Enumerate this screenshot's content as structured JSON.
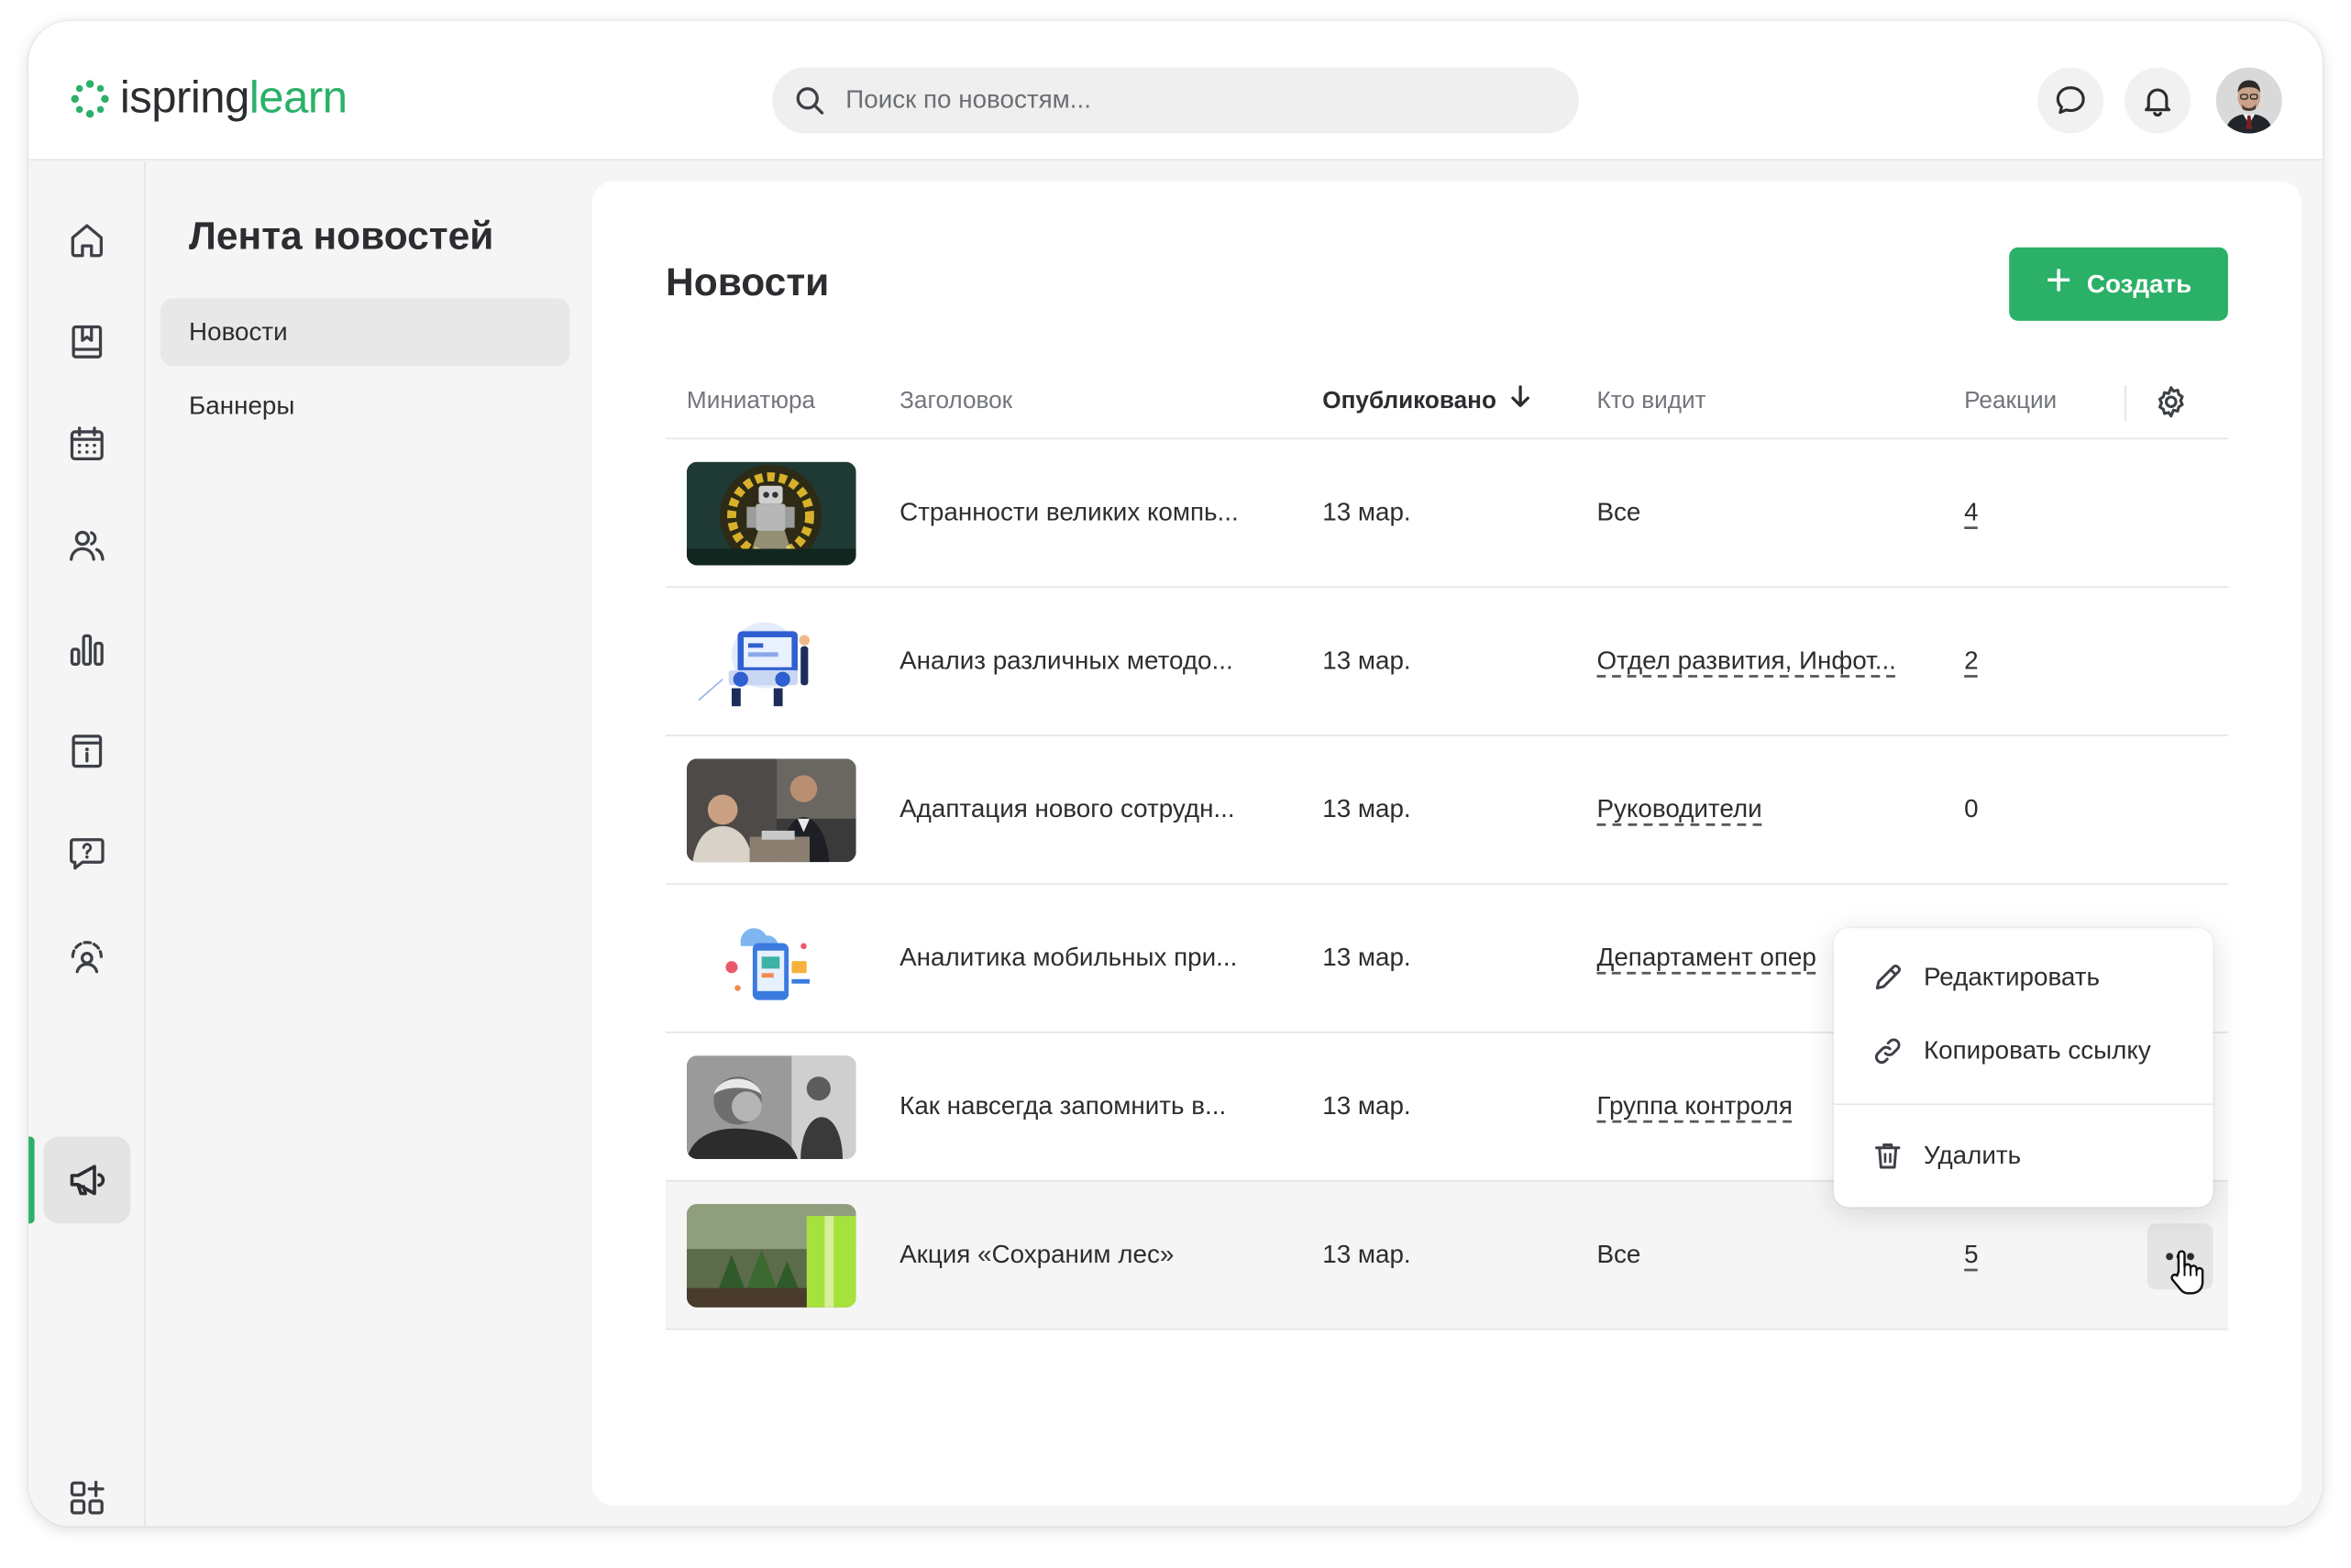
{
  "brand": {
    "part1": "ispring",
    "part2": "learn",
    "accent": "#2bb068"
  },
  "search": {
    "placeholder": "Поиск по новостям..."
  },
  "header_icons": [
    "chat-icon",
    "bell-icon",
    "avatar"
  ],
  "rail": [
    "home-icon",
    "book-icon",
    "calendar-icon",
    "users-icon",
    "chart-icon",
    "info-icon",
    "question-icon",
    "gauge-icon",
    "megaphone-icon",
    "add-apps-icon"
  ],
  "section": {
    "title": "Лента новостей",
    "items": [
      {
        "label": "Новости",
        "active": true
      },
      {
        "label": "Баннеры",
        "active": false
      }
    ]
  },
  "main": {
    "title": "Новости",
    "create_label": "Создать",
    "columns": {
      "thumb": "Миниатюра",
      "title": "Заголовок",
      "published": "Опубликовано",
      "who": "Кто видит",
      "reactions": "Реакции"
    },
    "rows": [
      {
        "title": "Странности великих компь...",
        "date": "13 мар.",
        "who": "Все",
        "reactions": "4"
      },
      {
        "title": "Анализ различных методо...",
        "date": "13 мар.",
        "who": "Отдел развития, Инфот...",
        "reactions": "2"
      },
      {
        "title": "Адаптация нового сотрудн...",
        "date": "13 мар.",
        "who": "Руководители",
        "reactions": "0"
      },
      {
        "title": "Аналитика мобильных при...",
        "date": "13 мар.",
        "who": "Департамент опер",
        "reactions": ""
      },
      {
        "title": "Как навсегда запомнить в...",
        "date": "13 мар.",
        "who": "Группа контроля",
        "reactions": ""
      },
      {
        "title": "Акция «Сохраним лес»",
        "date": "13 мар.",
        "who": "Все",
        "reactions": "5"
      }
    ]
  },
  "menu": {
    "edit": "Редактировать",
    "copy": "Копировать ссылку",
    "delete": "Удалить"
  }
}
